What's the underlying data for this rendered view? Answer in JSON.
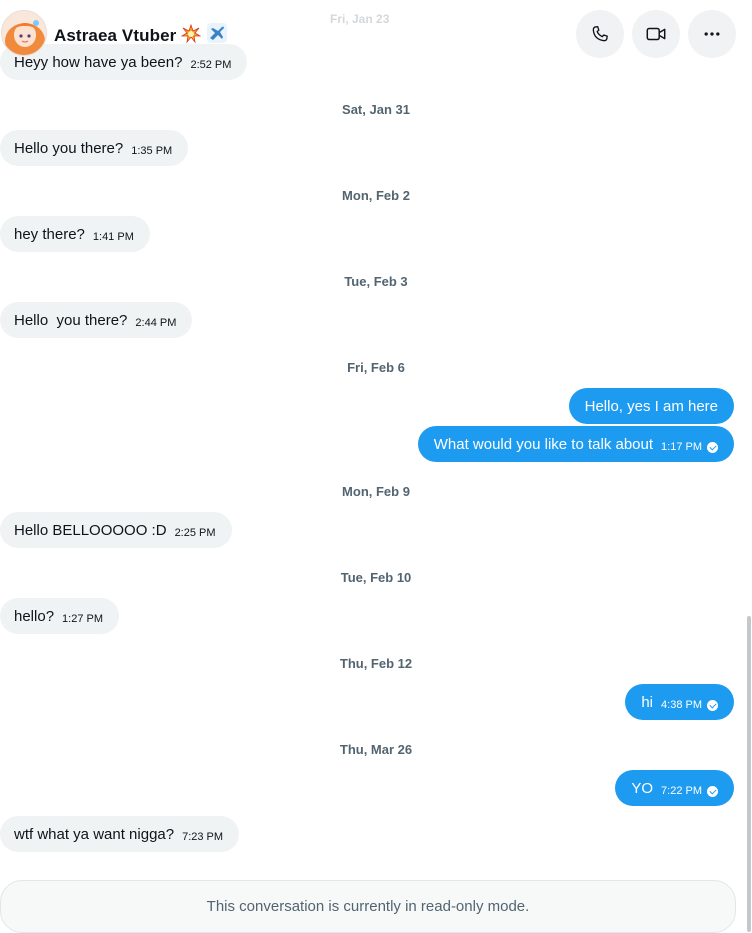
{
  "header": {
    "contact_name": "Astraea Vtuber",
    "faded_date": "Fri, Jan 23",
    "icons": [
      "phone-icon",
      "video-icon",
      "more-icon"
    ]
  },
  "messages": [
    {
      "type": "in",
      "text": "Heyy how have ya been?",
      "time": "2:52 PM"
    },
    {
      "type": "date",
      "text": "Sat, Jan 31"
    },
    {
      "type": "in",
      "text": "Hello you there?",
      "time": "1:35 PM"
    },
    {
      "type": "date",
      "text": "Mon, Feb 2"
    },
    {
      "type": "in",
      "text": "hey there?",
      "time": "1:41 PM"
    },
    {
      "type": "date",
      "text": "Tue, Feb 3"
    },
    {
      "type": "in",
      "text": "Hello  you there?",
      "time": "2:44 PM"
    },
    {
      "type": "date",
      "text": "Fri, Feb 6"
    },
    {
      "type": "out",
      "text": "Hello, yes I am here",
      "time": ""
    },
    {
      "type": "out",
      "text": "What would you like to talk about",
      "time": "1:17 PM"
    },
    {
      "type": "date",
      "text": "Mon, Feb 9"
    },
    {
      "type": "in",
      "text": "Hello BELLOOOOO :D",
      "time": "2:25 PM"
    },
    {
      "type": "date",
      "text": "Tue, Feb 10"
    },
    {
      "type": "in",
      "text": "hello?",
      "time": "1:27 PM"
    },
    {
      "type": "date",
      "text": "Thu, Feb 12"
    },
    {
      "type": "out",
      "text": "hi",
      "time": "4:38 PM"
    },
    {
      "type": "date",
      "text": "Thu, Mar 26"
    },
    {
      "type": "out",
      "text": "YO",
      "time": "7:22 PM"
    },
    {
      "type": "in",
      "text": "wtf what ya want nigga?",
      "time": "7:23 PM"
    }
  ],
  "footer": {
    "readonly_text": "This conversation is currently in read-only mode."
  },
  "colors": {
    "accent": "#1d9bf0",
    "incoming_bubble": "#eff3f4",
    "date_text": "#536471"
  }
}
